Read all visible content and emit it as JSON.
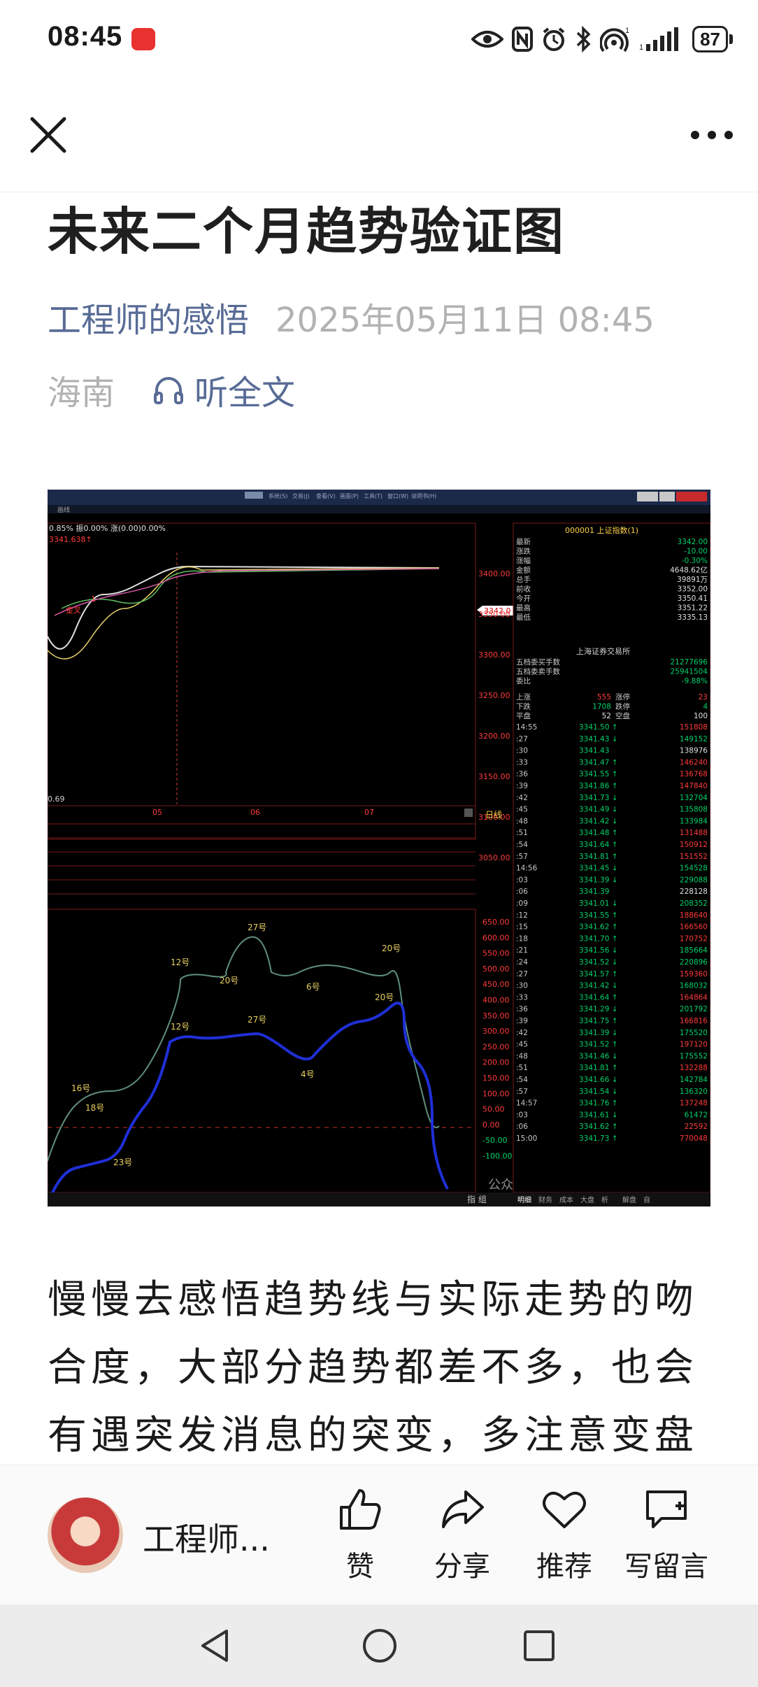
{
  "status_bar": {
    "time": "08:45",
    "battery": "87",
    "icons": [
      "eye-icon",
      "nfc-icon",
      "alarm-icon",
      "bluetooth-icon",
      "hotspot-icon",
      "signal-icon"
    ]
  },
  "nav": {
    "close_icon": "close-icon",
    "more_icon": "more-icon"
  },
  "article": {
    "title": "未来二个月趋势验证图",
    "author": "工程师的感悟",
    "date": "2025年05月11日 08:45",
    "region": "海南",
    "listen_label": "听全文",
    "body": "慢慢去感悟趋势线与实际走势的吻合度，大部分趋势都差不多，也会有遇突发消息的突变，多注意变盘"
  },
  "chart_image": {
    "index_code_title": "000001 上证指数(1)",
    "top_info": "0.85% 振0.00% 涨(0.00)0.00%",
    "high_marker": "3341.638↑",
    "low_marker": "0.69",
    "current_price_tag": "3342.0",
    "price_axis": [
      "3400.00",
      "3350.00",
      "3300.00",
      "3250.00",
      "3200.00",
      "3150.00",
      "3100.00",
      "3050.00"
    ],
    "month_labels": [
      "05",
      "06",
      "07"
    ],
    "period_label": "日线",
    "osc_axis": [
      "650.00",
      "600.00",
      "550.00",
      "500.00",
      "450.00",
      "400.00",
      "350.00",
      "300.00",
      "250.00",
      "200.00",
      "150.00",
      "100.00",
      "50.00",
      "0.00",
      "-50.00",
      "-100.00"
    ],
    "green_annotations": [
      "16号",
      "12号",
      "27号",
      "20号",
      "6号",
      "20号"
    ],
    "blue_annotations": [
      "18号",
      "23号",
      "12号",
      "27号",
      "4号",
      "20号"
    ],
    "overlay_labels": [
      "金叉",
      "1"
    ],
    "quote": [
      {
        "label": "最新",
        "value": "3342.00"
      },
      {
        "label": "涨跌",
        "value": "-10.00"
      },
      {
        "label": "涨幅",
        "value": "-0.30%"
      },
      {
        "label": "金额",
        "value": "4648.62亿"
      },
      {
        "label": "总手",
        "value": "39891万"
      },
      {
        "label": "前收",
        "value": "3352.00"
      },
      {
        "label": "今开",
        "value": "3350.41"
      },
      {
        "label": "最高",
        "value": "3351.22"
      },
      {
        "label": "最低",
        "value": "3335.13"
      }
    ],
    "exchange": "上海证券交易所",
    "orders": [
      {
        "label": "五档委买手数",
        "value": "21277696"
      },
      {
        "label": "五档委卖手数",
        "value": "25941504"
      },
      {
        "label": "委比",
        "value": "-9.88%"
      }
    ],
    "breadth": [
      {
        "l1": "上涨",
        "v1": "555",
        "l2": "涨停",
        "v2": "23"
      },
      {
        "l1": "下跌",
        "v1": "1708",
        "l2": "跌停",
        "v2": "4"
      },
      {
        "l1": "平盘",
        "v1": "52",
        "l2": "空盘",
        "v2": "100"
      }
    ],
    "ticks": [
      {
        "t": "14:55",
        "p": "3341.50",
        "d": "↑",
        "v": "151808"
      },
      {
        "t": ":27",
        "p": "3341.43",
        "d": "↓",
        "v": "149152"
      },
      {
        "t": ":30",
        "p": "3341.43",
        "d": "",
        "v": "138976"
      },
      {
        "t": ":33",
        "p": "3341.47",
        "d": "↑",
        "v": "146240"
      },
      {
        "t": ":36",
        "p": "3341.55",
        "d": "↑",
        "v": "136768"
      },
      {
        "t": ":39",
        "p": "3341.86",
        "d": "↑",
        "v": "147840"
      },
      {
        "t": ":42",
        "p": "3341.73",
        "d": "↓",
        "v": "132704"
      },
      {
        "t": ":45",
        "p": "3341.49",
        "d": "↓",
        "v": "135808"
      },
      {
        "t": ":48",
        "p": "3341.42",
        "d": "↓",
        "v": "133984"
      },
      {
        "t": ":51",
        "p": "3341.48",
        "d": "↑",
        "v": "131488"
      },
      {
        "t": ":54",
        "p": "3341.64",
        "d": "↑",
        "v": "150912"
      },
      {
        "t": ":57",
        "p": "3341.81",
        "d": "↑",
        "v": "151552"
      },
      {
        "t": "14:56",
        "p": "3341.45",
        "d": "↓",
        "v": "154528"
      },
      {
        "t": ":03",
        "p": "3341.39",
        "d": "↓",
        "v": "229088"
      },
      {
        "t": ":06",
        "p": "3341.39",
        "d": "",
        "v": "228128"
      },
      {
        "t": ":09",
        "p": "3341.01",
        "d": "↓",
        "v": "208352"
      },
      {
        "t": ":12",
        "p": "3341.55",
        "d": "↑",
        "v": "188640"
      },
      {
        "t": ":15",
        "p": "3341.62",
        "d": "↑",
        "v": "166560"
      },
      {
        "t": ":18",
        "p": "3341.70",
        "d": "↑",
        "v": "170752"
      },
      {
        "t": ":21",
        "p": "3341.56",
        "d": "↓",
        "v": "185664"
      },
      {
        "t": ":24",
        "p": "3341.52",
        "d": "↓",
        "v": "220896"
      },
      {
        "t": ":27",
        "p": "3341.57",
        "d": "↑",
        "v": "159360"
      },
      {
        "t": ":30",
        "p": "3341.42",
        "d": "↓",
        "v": "168032"
      },
      {
        "t": ":33",
        "p": "3341.64",
        "d": "↑",
        "v": "164864"
      },
      {
        "t": ":36",
        "p": "3341.29",
        "d": "↓",
        "v": "201792"
      },
      {
        "t": ":39",
        "p": "3341.75",
        "d": "↑",
        "v": "166816"
      },
      {
        "t": ":42",
        "p": "3341.39",
        "d": "↓",
        "v": "175520"
      },
      {
        "t": ":45",
        "p": "3341.52",
        "d": "↑",
        "v": "197120"
      },
      {
        "t": ":48",
        "p": "3341.46",
        "d": "↓",
        "v": "175552"
      },
      {
        "t": ":51",
        "p": "3341.81",
        "d": "↑",
        "v": "132288"
      },
      {
        "t": ":54",
        "p": "3341.66",
        "d": "↓",
        "v": "142784"
      },
      {
        "t": ":57",
        "p": "3341.54",
        "d": "↓",
        "v": "136320"
      },
      {
        "t": "14:57",
        "p": "3341.76",
        "d": "↑",
        "v": "137248"
      },
      {
        "t": ":03",
        "p": "3341.61",
        "d": "↓",
        "v": "61472"
      },
      {
        "t": ":06",
        "p": "3341.62",
        "d": "↑",
        "v": "22592"
      },
      {
        "t": "15:00",
        "p": "3341.73",
        "d": "↑",
        "v": "770048"
      }
    ],
    "watermark": "公众号 · 工程师的感悟",
    "bottom_tabs": [
      "明细",
      "财务",
      "成本",
      "大盘",
      "析",
      "解盘",
      "自"
    ],
    "bottom_left": "指 组"
  },
  "bottom_bar": {
    "author_short": "工程师...",
    "like_label": "赞",
    "share_label": "分享",
    "recommend_label": "推荐",
    "comment_label": "写留言"
  },
  "colors": {
    "link": "#576b95",
    "meta_gray": "#b2b2b2",
    "chart_up": "#ff3b3b",
    "chart_down": "#00d26a",
    "chart_green_line": "#5f8f7a",
    "chart_blue_line": "#1f2fd6"
  }
}
